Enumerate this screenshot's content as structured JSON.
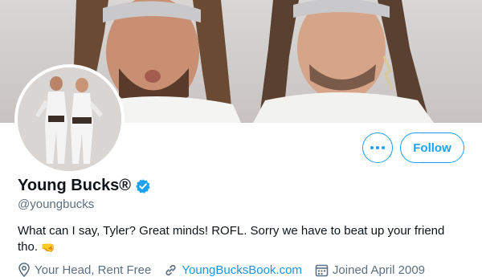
{
  "profile": {
    "display_name": "Young Bucks®",
    "handle": "@youngbucks",
    "bio": "What can I say, Tyler? Great minds! ROFL. Sorry we have to beat up your friend tho.",
    "bio_emoji": "🤜",
    "verified": true
  },
  "actions": {
    "more_icon": "more-horizontal-icon",
    "follow_label": "Follow"
  },
  "meta": {
    "location": "Your Head, Rent Free",
    "website": "YoungBucksBook.com",
    "joined": "Joined April 2009",
    "location_icon": "location-pin-icon",
    "website_icon": "link-icon",
    "joined_icon": "calendar-icon"
  },
  "colors": {
    "accent": "#1da1f2",
    "link": "#1b95e0",
    "secondary_text": "#5b7083",
    "primary_text": "#0f1419"
  }
}
